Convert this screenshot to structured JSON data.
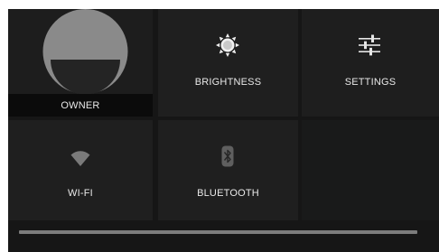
{
  "quick_settings": {
    "owner": {
      "label": "OWNER",
      "icon": "user-avatar-icon"
    },
    "brightness": {
      "label": "BRIGHTNESS",
      "icon": "sun-icon"
    },
    "settings": {
      "label": "SETTINGS",
      "icon": "sliders-icon"
    },
    "wifi": {
      "label": "WI-FI",
      "icon": "wifi-icon"
    },
    "bluetooth": {
      "label": "BLUETOOTH",
      "icon": "bluetooth-icon"
    }
  },
  "colors": {
    "panel_background": "#161616",
    "tile_background": "#1f1f1f",
    "label_text": "#e8e8e8",
    "icon_active": "#f0f0f0",
    "icon_dim": "#6e6e6e",
    "avatar_gray": "#8a8a8a"
  }
}
